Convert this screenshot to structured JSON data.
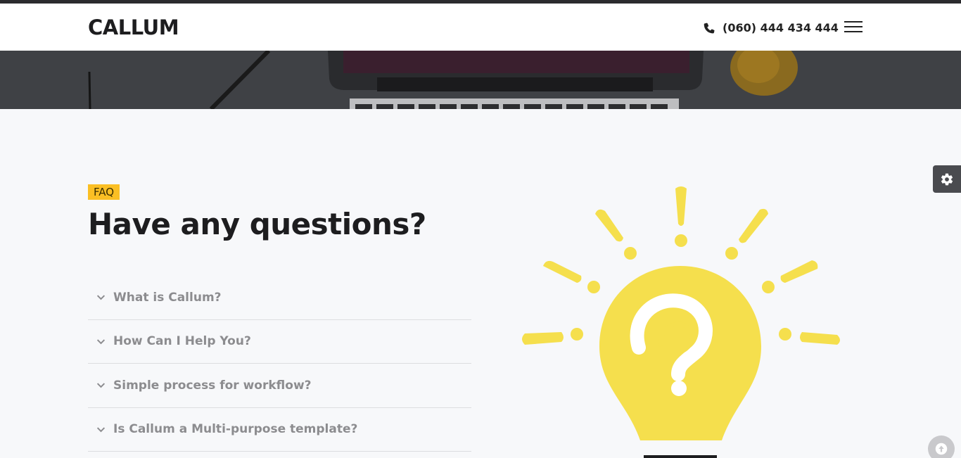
{
  "header": {
    "logo": "CALLUM",
    "phone": "(060) 444 434 444",
    "phone_icon": "phone-icon",
    "menu_icon": "hamburger-menu-icon"
  },
  "faq": {
    "badge": "FAQ",
    "title": "Have any questions?",
    "items": [
      {
        "question": "What is Callum?"
      },
      {
        "question": "How Can I Help You?"
      },
      {
        "question": "Simple process for workflow?"
      },
      {
        "question": "Is Callum a Multi-purpose template?"
      }
    ]
  },
  "widgets": {
    "settings_icon": "gear-icon",
    "scroll_top_icon": "arrow-up-icon"
  },
  "colors": {
    "accent": "#fbbf24",
    "bulb": "#f5df4d",
    "text_dark": "#1d1d1f",
    "text_muted": "#8c8c8f"
  }
}
